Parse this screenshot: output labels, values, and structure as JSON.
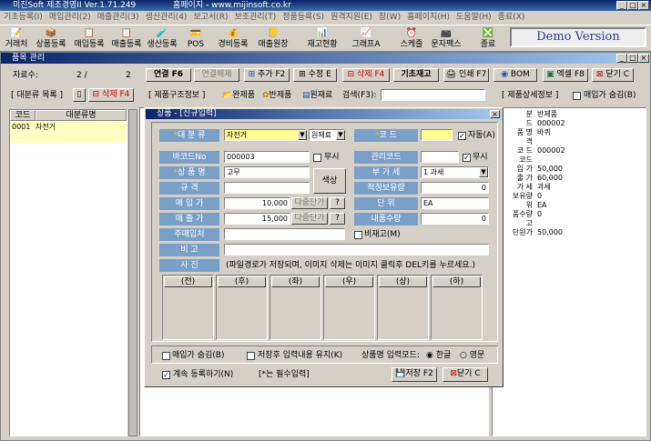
{
  "window": {
    "title": "미진Soft 제조경영II Ver.1.71.249",
    "homepage": "홈페이지 - www.mijinsoft.co.kr"
  },
  "menu": [
    "기초등록(I)",
    "매입관리(2)",
    "매출관리(3)",
    "생산관리(4)",
    "보고서(R)",
    "보조관리(T)",
    "정품등록(S)",
    "원격지원(E)",
    "창(W)",
    "홈페이지(H)",
    "도움말(H)",
    "종료(X)"
  ],
  "toolbar": {
    "items": [
      {
        "label": "거래처",
        "icon": "📝"
      },
      {
        "label": "상품등록",
        "icon": "📦"
      },
      {
        "label": "매입등록",
        "icon": "📋"
      },
      {
        "label": "매출등록",
        "icon": "📋"
      },
      {
        "label": "생산등록",
        "icon": "🧪"
      },
      {
        "label": "POS",
        "icon": "💳"
      },
      {
        "label": "경비등록",
        "icon": "💰"
      },
      {
        "label": "매출원장",
        "icon": "📒"
      },
      {
        "label": "재고현황",
        "icon": "📊"
      },
      {
        "label": "그래프A",
        "icon": "📈"
      },
      {
        "label": "스케줄",
        "icon": "⏰"
      },
      {
        "label": "문자팩스",
        "icon": "📠"
      },
      {
        "label": "종료",
        "icon": "❎"
      }
    ],
    "demo": "Demo Version"
  },
  "inner": {
    "title": "품목 관리",
    "record_label": "자료수:",
    "record_value": "2 /",
    "record_total": "2",
    "buttons": {
      "link": "연결 F6",
      "unlink": "연결해제",
      "add": "추가 F2",
      "edit": "수정 E",
      "del": "삭제 F4",
      "basic": "기초재고",
      "print": "인쇄 F7",
      "bom": "BOM",
      "excel": "엑셀 F8",
      "close": "닫기 C"
    },
    "cat_title": "[ 대분류 목록 ]",
    "cat_del": "삭제 F4",
    "struct_title": "[ 제품구조정보 ]",
    "opt_finished": "완제품",
    "opt_semi": "반제품",
    "opt_raw": "원재료",
    "search_label": "검색(F3):",
    "detail_title": "[ 제품상세정보 ]",
    "hide_buy": "매입가 숨김(B)",
    "grid_headers": [
      "코드",
      "대분류명"
    ],
    "grid_rows": [
      {
        "code": "0001",
        "name": "자전거"
      }
    ],
    "detail_rows": [
      {
        "k": "분",
        "v": "반제품"
      },
      {
        "k": "드",
        "v": "000002"
      },
      {
        "k": "품 명",
        "v": "바퀴"
      },
      {
        "k": "격",
        "v": ""
      },
      {
        "k": "코 드",
        "v": "000002"
      },
      {
        "k": "코드",
        "v": ""
      },
      {
        "k": "입 가",
        "v": "50,000"
      },
      {
        "k": "출 가",
        "v": "60,000"
      },
      {
        "k": "가 세",
        "v": "과세"
      },
      {
        "k": "보유량",
        "v": "0"
      },
      {
        "k": "위",
        "v": "EA"
      },
      {
        "k": "품수량",
        "v": "0"
      },
      {
        "k": "고",
        "v": ""
      },
      {
        "k": "단원가",
        "v": "50,000"
      }
    ]
  },
  "dialog": {
    "title": "상품 - [신규입력]",
    "labels": {
      "category": "대 분 류",
      "code": "코   드",
      "barcode": "바코드No",
      "manage_code": "관리코드",
      "name": "상 품 명",
      "vat": "부 가 세",
      "spec": "규   격",
      "stock_safe": "적정보유량",
      "buy": "매 입 가",
      "unit": "단   위",
      "sell": "매 출 가",
      "bom_qty": "내품수량",
      "supplier": "주매입처",
      "memo": "비   고",
      "photo": "사   진"
    },
    "values": {
      "category": "자전거",
      "category_sub": "원재료",
      "code": "",
      "barcode": "000003",
      "manage_code": "",
      "name": "고무",
      "vat": "1 과세",
      "spec": "",
      "stock_safe": "0",
      "buy": "10,000",
      "unit": "EA",
      "sell": "15,000",
      "bom_qty": "0",
      "supplier": "",
      "memo": ""
    },
    "auto": "자동(A)",
    "none1": "무시",
    "none2": "무시",
    "color_btn": "색상",
    "multi1": "다중단가",
    "multi2": "다중단가",
    "q1": "?",
    "q2": "?",
    "non_stock": "비재고(M)",
    "photo_note": "(파일경로가 저장되며, 이미지 삭제는 이미지 클릭후 DEL키를 누르세요.)",
    "photo_slots": [
      "(전)",
      "(후)",
      "(좌)",
      "(우)",
      "(상)",
      "(하)"
    ],
    "hide_buy": "매입가 숨김(B)",
    "keep_input": "저장후 입력내용 유지(K)",
    "mode_label": "상품명 입력모드:",
    "mode_ko": "한글",
    "mode_en": "영문",
    "continue": "계속 등록하기(N)",
    "required_note": "*는 필수입력",
    "save": "저장 F2",
    "close": "닫기 C"
  }
}
